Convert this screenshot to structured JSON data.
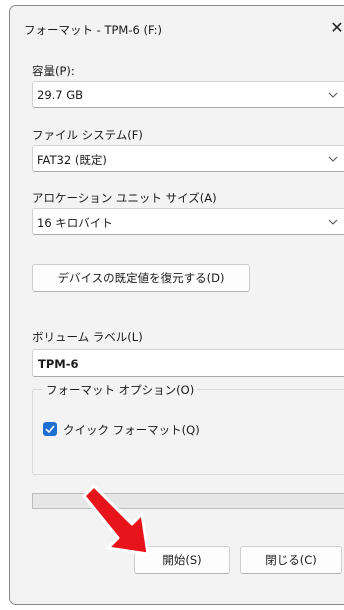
{
  "window": {
    "title": "フォーマット - TPM-6 (F:)",
    "close_glyph": "✕"
  },
  "capacity": {
    "label": "容量(P):",
    "value": "29.7 GB"
  },
  "file_system": {
    "label": "ファイル システム(F)",
    "value": "FAT32 (既定)"
  },
  "allocation": {
    "label": "アロケーション ユニット サイズ(A)",
    "value": "16 キロバイト"
  },
  "restore_defaults_label": "デバイスの既定値を復元する(D)",
  "volume_label": {
    "label": "ボリューム ラベル(L)",
    "value": "TPM-6"
  },
  "format_options": {
    "legend": "フォーマット オプション(O)",
    "quick_format": {
      "label": "クイック フォーマット(Q)",
      "checked": true
    }
  },
  "progress": {
    "fraction": 0
  },
  "buttons": {
    "start": "開始(S)",
    "close": "閉じる(C)"
  },
  "icons": {
    "close": "close-icon",
    "dropdown": "chevron-down-icon",
    "check": "checkmark-icon",
    "annotation": "red-arrow-icon"
  },
  "colors": {
    "accent": "#1f6fd1",
    "annotation_red": "#e8141c"
  }
}
